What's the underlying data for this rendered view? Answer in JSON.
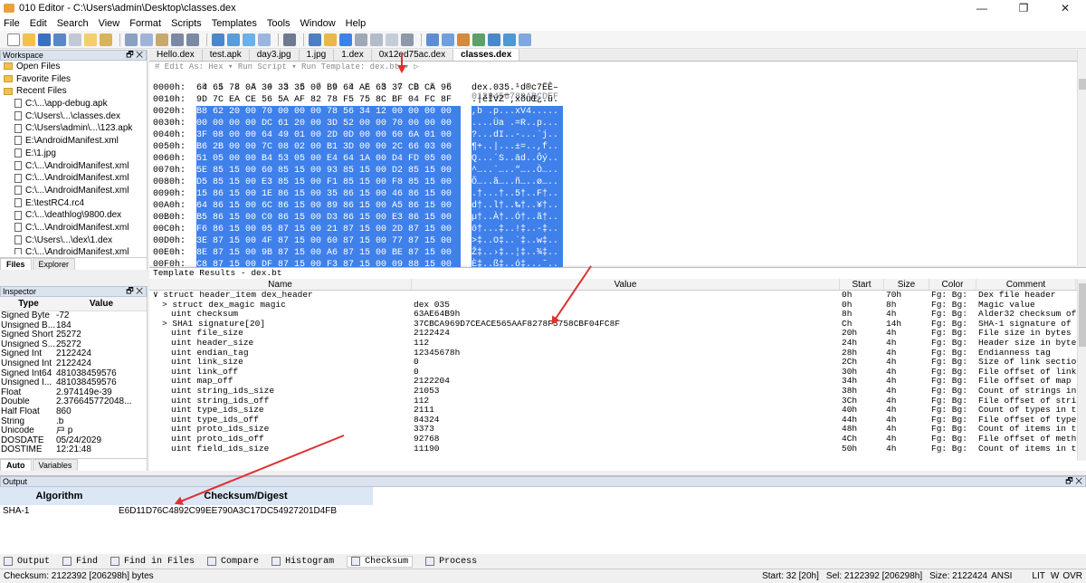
{
  "window": {
    "title": "010 Editor - C:\\Users\\admin\\Desktop\\classes.dex",
    "minimize": "—",
    "maximize": "❐",
    "close": "✕"
  },
  "menu": [
    "File",
    "Edit",
    "Search",
    "View",
    "Format",
    "Scripts",
    "Templates",
    "Tools",
    "Window",
    "Help"
  ],
  "workspace": {
    "title": "Workspace",
    "items": [
      {
        "label": "Open Files",
        "type": "folder"
      },
      {
        "label": "Favorite Files",
        "type": "folder"
      },
      {
        "label": "Recent Files",
        "type": "folder"
      },
      {
        "label": "C:\\...\\app-debug.apk",
        "type": "file"
      },
      {
        "label": "C:\\Users\\...\\classes.dex",
        "type": "file"
      },
      {
        "label": "C:\\Users\\admin\\...\\123.apk",
        "type": "file"
      },
      {
        "label": "E:\\AndroidManifest.xml",
        "type": "file"
      },
      {
        "label": "E:\\1.jpg",
        "type": "file"
      },
      {
        "label": "C:\\...\\AndroidManifest.xml",
        "type": "file"
      },
      {
        "label": "C:\\...\\AndroidManifest.xml",
        "type": "file"
      },
      {
        "label": "C:\\...\\AndroidManifest.xml",
        "type": "file"
      },
      {
        "label": "E:\\testRC4.rc4",
        "type": "file"
      },
      {
        "label": "C:\\...\\deathlog\\9800.dex",
        "type": "file"
      },
      {
        "label": "C:\\...\\AndroidManifest.xml",
        "type": "file"
      },
      {
        "label": "C:\\Users\\...\\dex\\1.dex",
        "type": "file"
      },
      {
        "label": "C:\\...\\AndroidManifest.xml",
        "type": "file"
      }
    ],
    "tabs": [
      "Files",
      "Explorer"
    ]
  },
  "inspector": {
    "title": "Inspector",
    "col_type": "Type",
    "col_value": "Value",
    "rows": [
      [
        "Signed Byte",
        "-72"
      ],
      [
        "Unsigned B...",
        "184"
      ],
      [
        "Signed Short",
        "25272"
      ],
      [
        "Unsigned S...",
        "25272"
      ],
      [
        "Signed Int",
        "2122424"
      ],
      [
        "Unsigned Int",
        "2122424"
      ],
      [
        "Signed Int64",
        "481038459576"
      ],
      [
        "Unsigned I...",
        "481038459576"
      ],
      [
        "Float",
        "2.974149e-39"
      ],
      [
        "Double",
        "2.376645772048..."
      ],
      [
        "Half Float",
        "860"
      ],
      [
        "String",
        ".b"
      ],
      [
        "Unicode",
        "戸 p"
      ],
      [
        "DOSDATE",
        "05/24/2029"
      ],
      [
        "DOSTIME",
        "12:21:48"
      ]
    ],
    "tabs": [
      "Auto",
      "Variables"
    ]
  },
  "editor": {
    "tabs": [
      "Hello.dex",
      "test.apk",
      "day3.jpg",
      "1.jpg",
      "1.dex",
      "0x12ed75ac.dex",
      "classes.dex"
    ],
    "active_tab": "classes.dex",
    "editbar": "# Edit As: Hex ▾   Run Script ▾   Run Template: dex.bt ▾   ▷",
    "col_header": " 0  1  2  3  4  5  6  7  8  9  A  B  C  D  E  F",
    "ascii_header": "0123456789ABCDEF",
    "rows": [
      {
        "addr": "0000h:",
        "bytes": "64 65 78 0A 30 33 35 00 B9 64 AE 63 37 CB CA 96",
        "ascii": "dex.035.¹d®c7ËÊ–",
        "sel": false
      },
      {
        "addr": "0010h:",
        "bytes": "9D 7C EA CE 56 5A AF 82 78 F5 75 8C BF 04 FC 8F",
        "ascii": ".|êÎVZ¯‚xõuŒ¿.ü.",
        "sel": false
      },
      {
        "addr": "0020h:",
        "bytes": "B8 62 20 00 70 00 00 00 78 56 34 12 00 00 00 00",
        "ascii": ",b .p...xV4.....",
        "sel": true
      },
      {
        "addr": "0030h:",
        "bytes": "00 00 00 00 DC 61 20 00 3D 52 00 00 70 00 00 00",
        "ascii": "....Üa .=R..p...",
        "sel": true
      },
      {
        "addr": "0040h:",
        "bytes": "3F 08 00 00 64 49 01 00 2D 0D 00 00 60 6A 01 00",
        "ascii": "?...dI..-...`j..",
        "sel": true
      },
      {
        "addr": "0050h:",
        "bytes": "B6 2B 00 00 7C 08 02 00 B1 3D 00 00 2C 66 03 00",
        "ascii": "¶+..|...±=..,f..",
        "sel": true
      },
      {
        "addr": "0060h:",
        "bytes": "51 05 00 00 B4 53 05 00 E4 64 1A 00 D4 FD 05 00",
        "ascii": "Q...´S..äd..Ôý..",
        "sel": true
      },
      {
        "addr": "0070h:",
        "bytes": "5E 85 15 00 60 85 15 00 93 85 15 00 D2 85 15 00",
        "ascii": "^…..`…..“…..Ò…..",
        "sel": true
      },
      {
        "addr": "0080h:",
        "bytes": "D5 85 15 00 E3 85 15 00 F1 85 15 00 F8 85 15 00",
        "ascii": "Õ…..ã…..ñ…..ø…..",
        "sel": true
      },
      {
        "addr": "0090h:",
        "bytes": "15 86 15 00 1E 86 15 00 35 86 15 00 46 86 15 00",
        "ascii": ".†...†..5†..F†..",
        "sel": true
      },
      {
        "addr": "00A0h:",
        "bytes": "64 86 15 00 6C 86 15 00 89 86 15 00 A5 86 15 00",
        "ascii": "d†..l†..‰†..¥†..",
        "sel": true
      },
      {
        "addr": "00B0h:",
        "bytes": "B5 86 15 00 C0 86 15 00 D3 86 15 00 E3 86 15 00",
        "ascii": "µ†..À†..Ó†..ã†..",
        "sel": true
      },
      {
        "addr": "00C0h:",
        "bytes": "F6 86 15 00 05 87 15 00 21 87 15 00 2D 87 15 00",
        "ascii": "ö†...‡..!‡..-‡..",
        "sel": true
      },
      {
        "addr": "00D0h:",
        "bytes": "3E 87 15 00 4F 87 15 00 60 87 15 00 77 87 15 00",
        "ascii": ">‡..O‡..`‡..w‡..",
        "sel": true
      },
      {
        "addr": "00E0h:",
        "bytes": "8E 87 15 00 9B 87 15 00 A6 87 15 00 BE 87 15 00",
        "ascii": "Ž‡..›‡..¦‡..¾‡..",
        "sel": true
      },
      {
        "addr": "00F0h:",
        "bytes": "C8 87 15 00 DF 87 15 00 F3 87 15 00 09 88 15 00",
        "ascii": "È‡..ß‡..ó‡...ˆ..",
        "sel": true
      }
    ]
  },
  "template": {
    "title": "Template Results - dex.bt",
    "columns": [
      "Name",
      "Value",
      "Start",
      "Size",
      "Color",
      "Comment"
    ],
    "rows": [
      {
        "name": "∨ struct header_item dex_header",
        "value": "",
        "start": "0h",
        "size": "70h",
        "color": "Fg:  Bg:",
        "comment": "Dex file header",
        "indent": 0
      },
      {
        "name": "> struct dex_magic magic",
        "value": "dex 035",
        "start": "0h",
        "size": "8h",
        "color": "Fg:  Bg:",
        "comment": "Magic value",
        "indent": 1
      },
      {
        "name": "uint checksum",
        "value": "63AE64B9h",
        "start": "8h",
        "size": "4h",
        "color": "Fg:  Bg:",
        "comment": "Alder32 checksum of r",
        "indent": 2
      },
      {
        "name": "> SHA1 signature[20]",
        "value": "37CBCA969D7CEACE565AAF8278F5758CBF04FC8F",
        "start": "Ch",
        "size": "14h",
        "color": "Fg:  Bg:",
        "comment": "SHA-1 signature of re",
        "indent": 1
      },
      {
        "name": "uint file_size",
        "value": "2122424",
        "start": "20h",
        "size": "4h",
        "color": "Fg:  Bg:",
        "comment": "File size in bytes",
        "indent": 2
      },
      {
        "name": "uint header_size",
        "value": "112",
        "start": "24h",
        "size": "4h",
        "color": "Fg:  Bg:",
        "comment": "Header size in bytes",
        "indent": 2
      },
      {
        "name": "uint endian_tag",
        "value": "12345678h",
        "start": "28h",
        "size": "4h",
        "color": "Fg:  Bg:",
        "comment": "Endianness tag",
        "indent": 2
      },
      {
        "name": "uint link_size",
        "value": "0",
        "start": "2Ch",
        "size": "4h",
        "color": "Fg:  Bg:",
        "comment": "Size of link section",
        "indent": 2
      },
      {
        "name": "uint link_off",
        "value": "0",
        "start": "30h",
        "size": "4h",
        "color": "Fg:  Bg:",
        "comment": "File offset of link s",
        "indent": 2
      },
      {
        "name": "uint map_off",
        "value": "2122204",
        "start": "34h",
        "size": "4h",
        "color": "Fg:  Bg:",
        "comment": "File offset of map li",
        "indent": 2
      },
      {
        "name": "uint string_ids_size",
        "value": "21053",
        "start": "38h",
        "size": "4h",
        "color": "Fg:  Bg:",
        "comment": "Count of strings in t",
        "indent": 2
      },
      {
        "name": "uint string_ids_off",
        "value": "112",
        "start": "3Ch",
        "size": "4h",
        "color": "Fg:  Bg:",
        "comment": "File offset of string",
        "indent": 2
      },
      {
        "name": "uint type_ids_size",
        "value": "2111",
        "start": "40h",
        "size": "4h",
        "color": "Fg:  Bg:",
        "comment": "Count of types in the",
        "indent": 2
      },
      {
        "name": "uint type_ids_off",
        "value": "84324",
        "start": "44h",
        "size": "4h",
        "color": "Fg:  Bg:",
        "comment": "File offset of type I",
        "indent": 2
      },
      {
        "name": "uint proto_ids_size",
        "value": "3373",
        "start": "48h",
        "size": "4h",
        "color": "Fg:  Bg:",
        "comment": "Count of items in the",
        "indent": 2
      },
      {
        "name": "uint proto_ids_off",
        "value": "92768",
        "start": "4Ch",
        "size": "4h",
        "color": "Fg:  Bg:",
        "comment": "File offset of method",
        "indent": 2
      },
      {
        "name": "uint field_ids_size",
        "value": "11190",
        "start": "50h",
        "size": "4h",
        "color": "Fg:  Bg:",
        "comment": "Count of items in the",
        "indent": 2
      }
    ]
  },
  "output": {
    "title": "Output",
    "col_algorithm": "Algorithm",
    "col_checksum": "Checksum/Digest",
    "row_algorithm": "SHA-1",
    "row_checksum": "E6D11D76C4892C99EE790A3C17DC54927201D4FB"
  },
  "bottom_tabs": [
    "Output",
    "Find",
    "Find in Files",
    "Compare",
    "Histogram",
    "Checksum",
    "Process"
  ],
  "active_bottom_tab": "Checksum",
  "status": {
    "left": "Checksum: 2122392 [206298h] bytes",
    "start": "Start: 32 [20h]",
    "sel": "Sel: 2122392 [206298h]",
    "size": "Size: 2122424",
    "encoding": "ANSI",
    "endian": "LIT",
    "mode1": "W",
    "mode2": "OVR"
  },
  "colors": {
    "selection": "#3f80ea",
    "arrow": "#e03030",
    "panel_header": "#dbe3ef"
  }
}
